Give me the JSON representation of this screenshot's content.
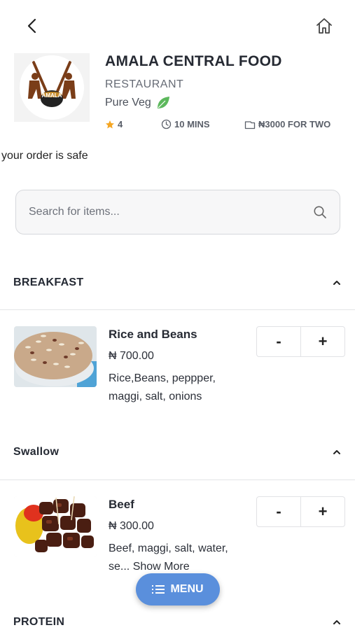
{
  "restaurant": {
    "name": "AMALA CENTRAL FOOD",
    "type": "RESTAURANT",
    "veg_label": "Pure Veg",
    "logo_text": "AMALA",
    "rating": "4",
    "delivery_time": "10 MINS",
    "price_for_two": "₦3000 FOR TWO"
  },
  "notice": "your order is safe",
  "search": {
    "placeholder": "Search for items..."
  },
  "categories": [
    {
      "title": "BREAKFAST",
      "items": [
        {
          "name": "Rice and Beans",
          "price": "₦ 700.00",
          "description": "Rice,Beans, peppper, maggi, salt, onions"
        }
      ]
    },
    {
      "title": "Swallow",
      "items": [
        {
          "name": "Beef",
          "price": "₦ 300.00",
          "description": "Beef, maggi, salt, water, se...",
          "show_more": "Show More"
        }
      ]
    },
    {
      "title": "PROTEIN",
      "items": []
    }
  ],
  "qty_controls": {
    "minus": "-",
    "plus": "+"
  },
  "menu_button": {
    "label": "MENU"
  },
  "colors": {
    "accent": "#5a8fdc",
    "star": "#f5a623",
    "leaf": "#5cb85c"
  },
  "icons": [
    "back-arrow-icon",
    "home-icon",
    "star-icon",
    "clock-icon",
    "wallet-icon",
    "leaf-icon",
    "search-icon",
    "chevron-up-icon",
    "menu-list-icon"
  ]
}
